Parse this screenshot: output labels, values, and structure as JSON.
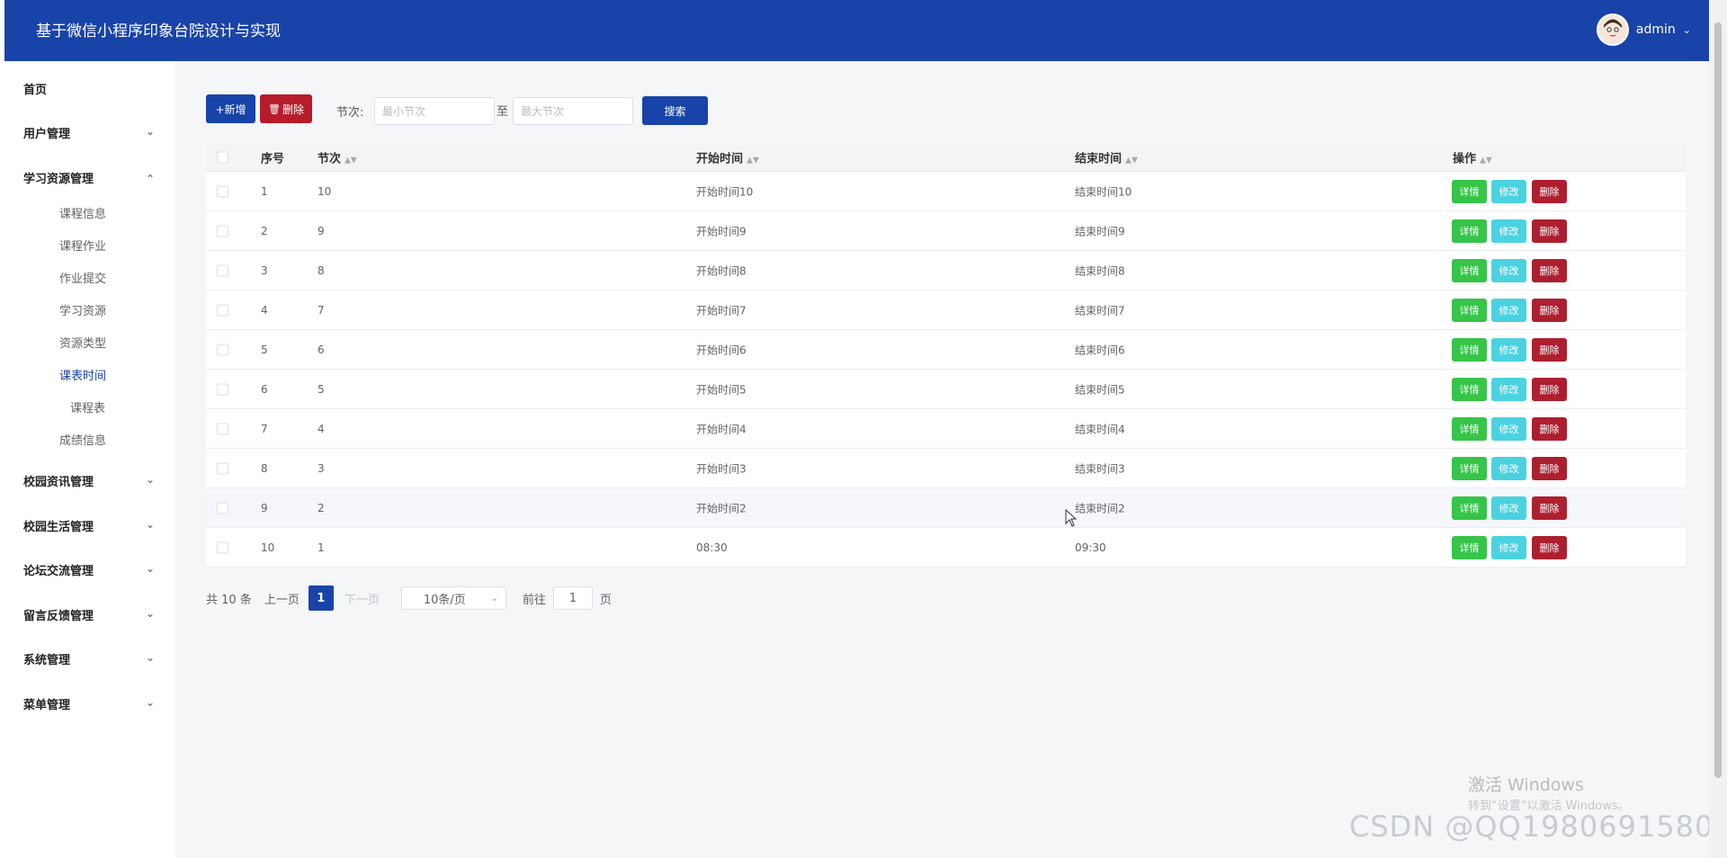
{
  "header": {
    "title": "基于微信小程序印象台院设计与实现",
    "username": "admin"
  },
  "sidebar": {
    "home": "首页",
    "menus": [
      {
        "label": "用户管理",
        "expanded": false
      },
      {
        "label": "学习资源管理",
        "expanded": true
      },
      {
        "label": "校园资讯管理",
        "expanded": false
      },
      {
        "label": "校园生活管理",
        "expanded": false
      },
      {
        "label": "论坛交流管理",
        "expanded": false
      },
      {
        "label": "留言反馈管理",
        "expanded": false
      },
      {
        "label": "系统管理",
        "expanded": false
      },
      {
        "label": "菜单管理",
        "expanded": false
      }
    ],
    "subitems": [
      "课程信息",
      "课程作业",
      "作业提交",
      "学习资源",
      "资源类型",
      "课表时间",
      "课程表",
      "成绩信息"
    ],
    "active_sub": "课表时间"
  },
  "toolbar": {
    "add_label": "+新增",
    "delete_label": "删除",
    "section_label": "节次:",
    "min_placeholder": "最小节次",
    "to_label": "至",
    "max_placeholder": "最大节次",
    "search_label": "搜索"
  },
  "table": {
    "headers": {
      "index": "序号",
      "section": "节次",
      "start": "开始时间",
      "end": "结束时间",
      "ops": "操作"
    },
    "actions": {
      "detail": "详情",
      "edit": "修改",
      "delete": "删除"
    },
    "rows": [
      {
        "index": "1",
        "section": "10",
        "start": "开始时间10",
        "end": "结束时间10"
      },
      {
        "index": "2",
        "section": "9",
        "start": "开始时间9",
        "end": "结束时间9"
      },
      {
        "index": "3",
        "section": "8",
        "start": "开始时间8",
        "end": "结束时间8"
      },
      {
        "index": "4",
        "section": "7",
        "start": "开始时间7",
        "end": "结束时间7"
      },
      {
        "index": "5",
        "section": "6",
        "start": "开始时间6",
        "end": "结束时间6"
      },
      {
        "index": "6",
        "section": "5",
        "start": "开始时间5",
        "end": "结束时间5"
      },
      {
        "index": "7",
        "section": "4",
        "start": "开始时间4",
        "end": "结束时间4"
      },
      {
        "index": "8",
        "section": "3",
        "start": "开始时间3",
        "end": "结束时间3"
      },
      {
        "index": "9",
        "section": "2",
        "start": "开始时间2",
        "end": "结束时间2"
      },
      {
        "index": "10",
        "section": "1",
        "start": "08:30",
        "end": "09:30"
      }
    ]
  },
  "pagination": {
    "total": "共 10 条",
    "prev": "上一页",
    "current": "1",
    "next": "下一页",
    "page_size": "10条/页",
    "goto_label": "前往",
    "goto_value": "1",
    "page_suffix": "页"
  },
  "overlay": {
    "win_activate": "激活 Windows",
    "win_activate_hint": "转到“设置”以激活 Windows。",
    "watermark": "CSDN @QQ1980691580"
  },
  "colors": {
    "primary": "#1843a8",
    "danger": "#b71c2b",
    "success": "#36c449",
    "info": "#4bd2e0"
  }
}
